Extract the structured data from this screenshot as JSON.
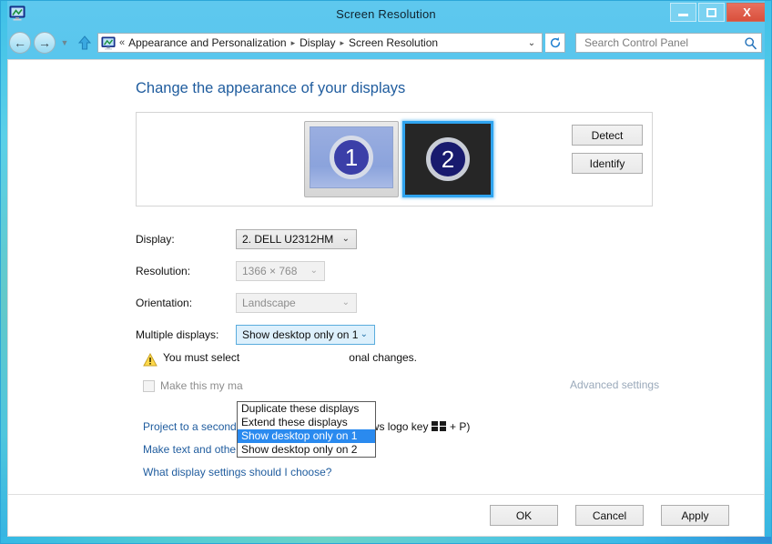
{
  "window": {
    "title": "Screen Resolution",
    "app_icon": "display-monitor-icon",
    "minimize_label": "Minimize",
    "maximize_label": "Maximize",
    "close_label": "X"
  },
  "nav": {
    "back_glyph": "←",
    "forward_glyph": "→",
    "history_glyph": "▼",
    "up_glyph": "↑",
    "address_icon": "display-monitor-icon",
    "overflow_chevron": "«",
    "breadcrumbs": [
      {
        "label": "Appearance and Personalization"
      },
      {
        "label": "Display"
      },
      {
        "label": "Screen Resolution"
      }
    ],
    "breadcrumb_separator": "▸",
    "address_dropdown_glyph": "⌄",
    "refresh_icon": "refresh-icon",
    "search_placeholder": "Search Control Panel",
    "search_value": "",
    "search_icon": "search-icon"
  },
  "page": {
    "heading": "Change the appearance of your displays",
    "preview": {
      "monitors": [
        {
          "number": "1",
          "state": "unselected"
        },
        {
          "number": "2",
          "state": "selected"
        }
      ],
      "detect_label": "Detect",
      "identify_label": "Identify"
    },
    "fields": {
      "display_label": "Display:",
      "display_value": "2. DELL U2312HM",
      "resolution_label": "Resolution:",
      "resolution_value": "1366 × 768",
      "orientation_label": "Orientation:",
      "orientation_value": "Landscape",
      "multiple_displays_label": "Multiple displays:",
      "multiple_displays_value": "Show desktop only on 1",
      "dropdown_arrow": "⌄"
    },
    "multiple_displays_options": [
      {
        "label": "Duplicate these displays",
        "selected": false
      },
      {
        "label": "Extend these displays",
        "selected": false
      },
      {
        "label": "Show desktop only on 1",
        "selected": true
      },
      {
        "label": "Show desktop only on 2",
        "selected": false
      }
    ],
    "warning": {
      "icon": "warning-triangle-icon",
      "text_before": "You must select",
      "text_after": "onal changes."
    },
    "main_display_checkbox": {
      "label": "Make this my ma",
      "checked": false,
      "enabled": false
    },
    "advanced_settings_label": "Advanced settings",
    "links": [
      {
        "label": "Project to a second screen",
        "suffix_before": "(or press the Windows logo key",
        "suffix_after": "+ P)",
        "has_windows_glyph": true
      },
      {
        "label": "Make text and other items larger or smaller",
        "suffix_before": "",
        "suffix_after": "",
        "has_windows_glyph": false
      },
      {
        "label": "What display settings should I choose?",
        "suffix_before": "",
        "suffix_after": "",
        "has_windows_glyph": false
      }
    ]
  },
  "footer": {
    "ok_label": "OK",
    "cancel_label": "Cancel",
    "apply_label": "Apply"
  },
  "colors": {
    "frame": "#49bfe9",
    "heading": "#1f5c9e",
    "link": "#1f5c9e",
    "selection": "#2a8aef",
    "close_button": "#d9503c",
    "disabled_text": "#8d8d8d"
  }
}
